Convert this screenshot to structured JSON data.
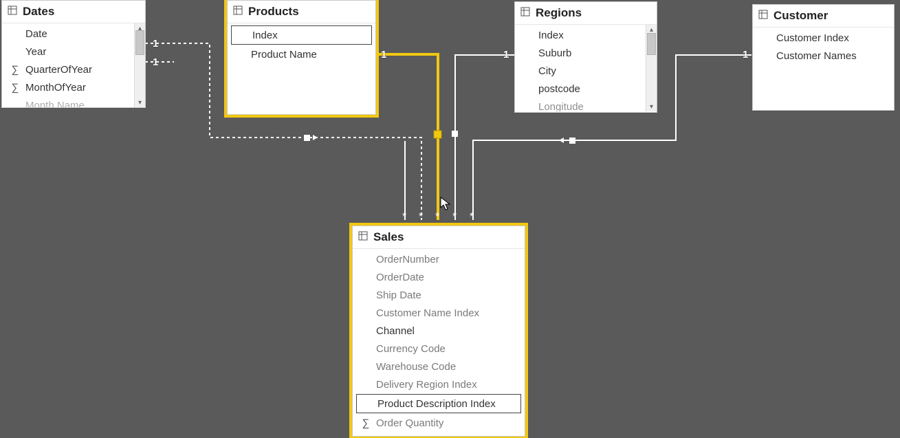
{
  "tables": {
    "dates": {
      "title": "Dates",
      "fields": [
        "Date",
        "Year",
        "QuarterOfYear",
        "MonthOfYear",
        "Month Name"
      ],
      "aggIcons": {
        "QuarterOfYear": true,
        "MonthOfYear": true
      }
    },
    "products": {
      "title": "Products",
      "fields": [
        "Index",
        "Product Name"
      ]
    },
    "regions": {
      "title": "Regions",
      "fields": [
        "Index",
        "Suburb",
        "City",
        "postcode",
        "Longitude"
      ]
    },
    "customer": {
      "title": "Customer",
      "fields": [
        "Customer Index",
        "Customer Names"
      ]
    },
    "sales": {
      "title": "Sales",
      "fields": [
        "OrderNumber",
        "OrderDate",
        "Ship Date",
        "Customer Name Index",
        "Channel",
        "Currency Code",
        "Warehouse Code",
        "Delivery Region Index",
        "Product Description Index",
        "Order Quantity"
      ],
      "aggIcons": {
        "Order Quantity": true
      }
    }
  },
  "cardinality": {
    "one": "1",
    "many": "*"
  },
  "colors": {
    "accent": "#f2c811",
    "canvas": "#5a5a5a"
  }
}
